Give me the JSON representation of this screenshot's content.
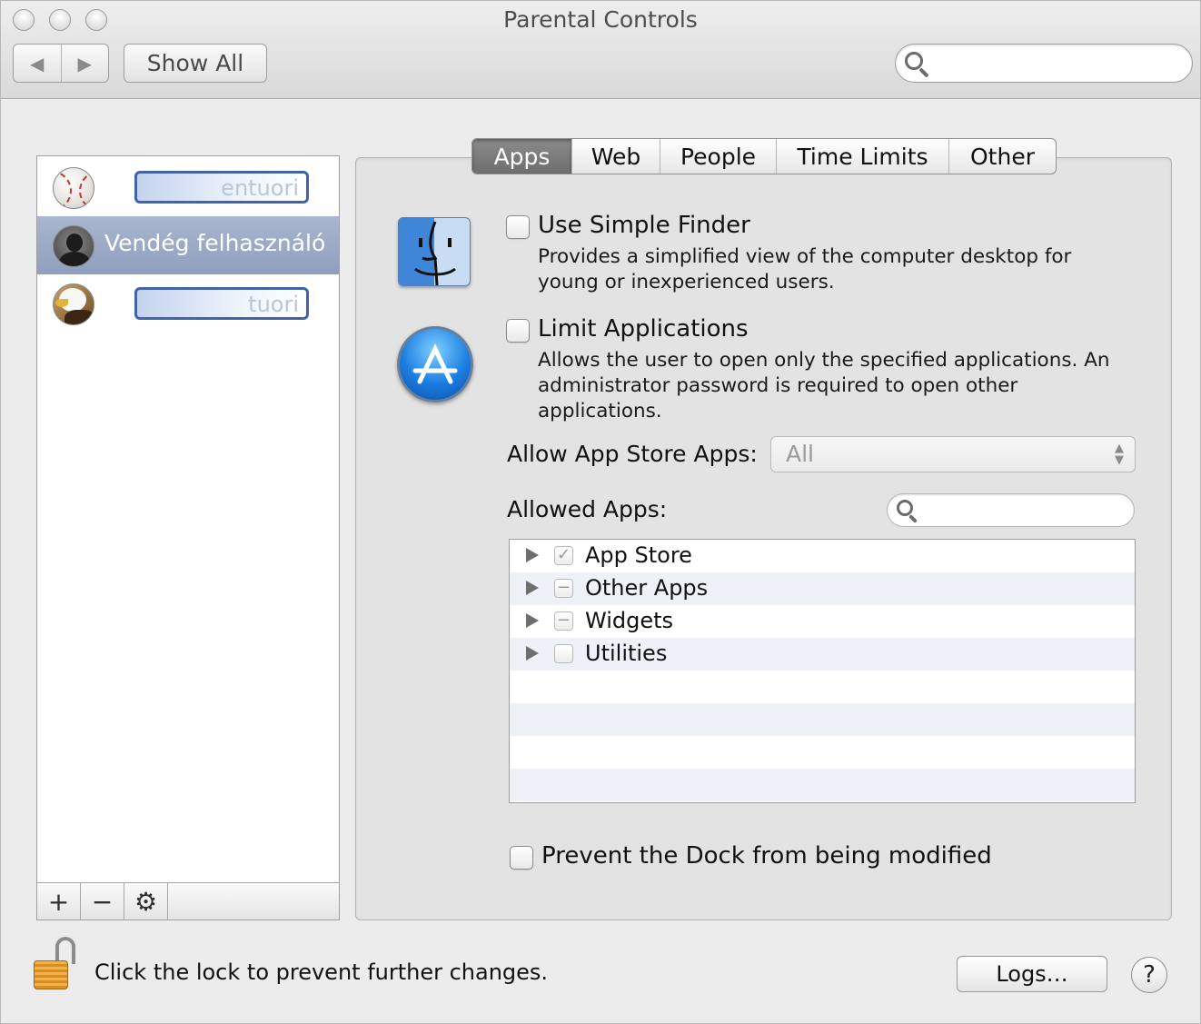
{
  "window": {
    "title": "Parental Controls",
    "show_all_label": "Show All",
    "search_placeholder": ""
  },
  "users": [
    {
      "name": "entuori",
      "avatar": "baseball-avatar",
      "editing": true
    },
    {
      "name": "Vendég felhasználó",
      "avatar": "guest-avatar",
      "selected": true
    },
    {
      "name": "tuori",
      "avatar": "eagle-avatar",
      "editing": true
    }
  ],
  "list_toolbar": {
    "add": "+",
    "remove": "−",
    "action": "gear-icon"
  },
  "tabs": [
    {
      "label": "Apps",
      "active": true
    },
    {
      "label": "Web"
    },
    {
      "label": "People"
    },
    {
      "label": "Time Limits"
    },
    {
      "label": "Other"
    }
  ],
  "apps_tab": {
    "simple_finder": {
      "title": "Use Simple Finder",
      "description": "Provides a simplified view of the computer desktop for young or inexperienced users.",
      "checked": false,
      "icon": "finder-icon"
    },
    "limit_apps": {
      "title": "Limit Applications",
      "description": "Allows the user to open only the specified applications. An administrator password is required to open other applications.",
      "checked": false,
      "icon": "app-store-icon"
    },
    "allow_store_label": "Allow App Store Apps:",
    "allow_store_value": "All",
    "allowed_apps_label": "Allowed Apps:",
    "allowed_apps": [
      {
        "name": "App Store",
        "state": "checked"
      },
      {
        "name": "Other Apps",
        "state": "mixed"
      },
      {
        "name": "Widgets",
        "state": "mixed"
      },
      {
        "name": "Utilities",
        "state": "unchecked"
      }
    ],
    "prevent_dock": {
      "title": "Prevent the Dock from being modified",
      "checked": false
    }
  },
  "footer": {
    "lock_text": "Click the lock to prevent further changes.",
    "logs_label": "Logs…",
    "help_label": "?"
  },
  "colors": {
    "selection": "#98a7c3",
    "active_tab": "#7c7c7c",
    "edit_border": "#3f64a8"
  }
}
